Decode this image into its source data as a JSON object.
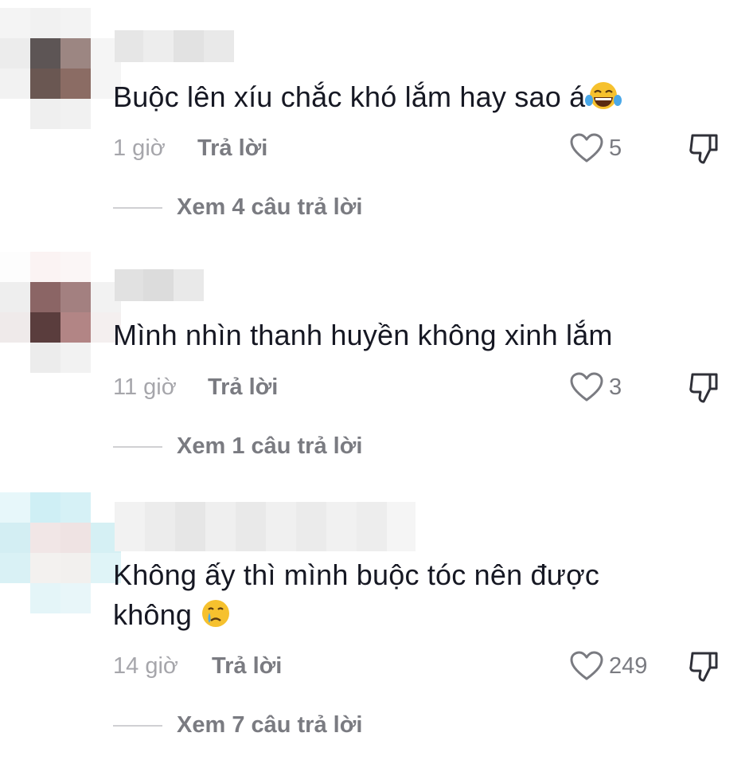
{
  "comments": [
    {
      "text": "Buộc lên xíu chắc khó lắm hay sao á",
      "emoji": "laughing-tears-emoji",
      "time": "1 giờ",
      "reply_label": "Trả lời",
      "likes": "5",
      "view_replies": "Xem 4 câu trả lời"
    },
    {
      "text": "Mình nhìn thanh huyền không xinh lắm",
      "time": "11 giờ",
      "reply_label": "Trả lời",
      "likes": "3",
      "view_replies": "Xem 1 câu trả lời"
    },
    {
      "text_line1": "Không ấy thì mình buộc tóc nên được",
      "text_line2": "không",
      "emoji": "crying-face-emoji",
      "time": "14 giờ",
      "reply_label": "Trả lời",
      "likes": "249",
      "view_replies": "Xem 7 câu trả lời"
    }
  ],
  "icons": {
    "like": "heart-outline-icon",
    "dislike": "thumbs-down-icon"
  },
  "colors": {
    "text": "#161823",
    "secondary": "#7a7b81",
    "time": "#a6a6ab"
  }
}
